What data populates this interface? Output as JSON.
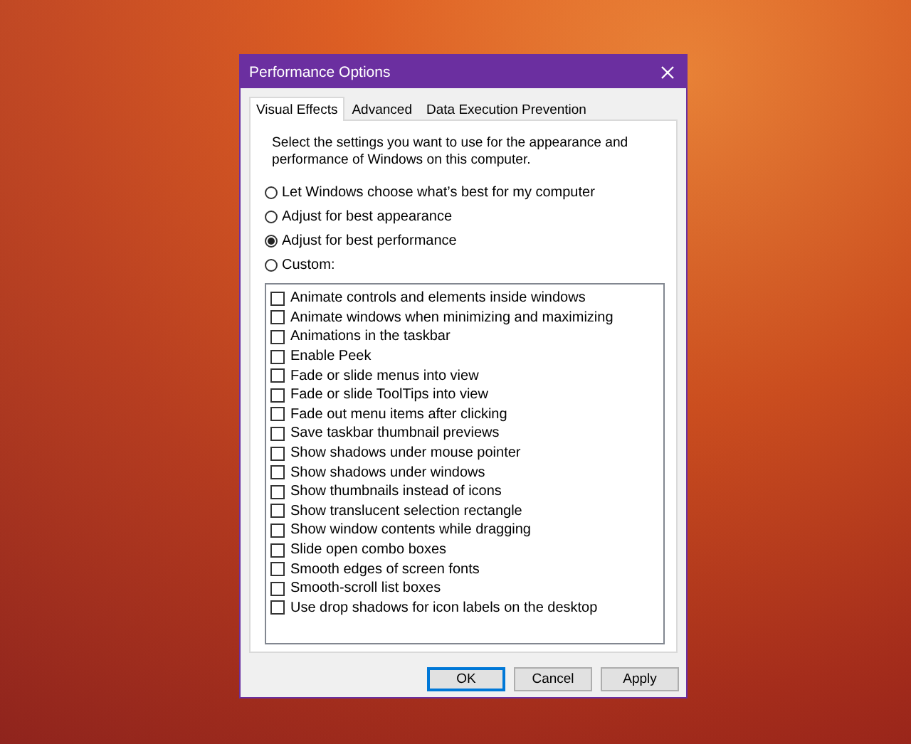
{
  "window": {
    "title": "Performance Options"
  },
  "tabs": [
    {
      "label": "Visual Effects",
      "selected": true
    },
    {
      "label": "Advanced",
      "selected": false
    },
    {
      "label": "Data Execution Prevention",
      "selected": false
    }
  ],
  "description": "Select the settings you want to use for the appearance and performance of Windows on this computer.",
  "options": [
    {
      "label": "Let Windows choose what’s best for my computer",
      "selected": false
    },
    {
      "label": "Adjust for best appearance",
      "selected": false
    },
    {
      "label": "Adjust for best performance",
      "selected": true
    },
    {
      "label": "Custom:",
      "selected": false
    }
  ],
  "effects": [
    {
      "label": "Animate controls and elements inside windows",
      "checked": false
    },
    {
      "label": "Animate windows when minimizing and maximizing",
      "checked": false
    },
    {
      "label": "Animations in the taskbar",
      "checked": false
    },
    {
      "label": "Enable Peek",
      "checked": false
    },
    {
      "label": "Fade or slide menus into view",
      "checked": false
    },
    {
      "label": "Fade or slide ToolTips into view",
      "checked": false
    },
    {
      "label": "Fade out menu items after clicking",
      "checked": false
    },
    {
      "label": "Save taskbar thumbnail previews",
      "checked": false
    },
    {
      "label": "Show shadows under mouse pointer",
      "checked": false
    },
    {
      "label": "Show shadows under windows",
      "checked": false
    },
    {
      "label": "Show thumbnails instead of icons",
      "checked": false
    },
    {
      "label": "Show translucent selection rectangle",
      "checked": false
    },
    {
      "label": "Show window contents while dragging",
      "checked": false
    },
    {
      "label": "Slide open combo boxes",
      "checked": false
    },
    {
      "label": "Smooth edges of screen fonts",
      "checked": false
    },
    {
      "label": "Smooth-scroll list boxes",
      "checked": false
    },
    {
      "label": "Use drop shadows for icon labels on the desktop",
      "checked": false
    }
  ],
  "buttons": [
    {
      "label": "OK",
      "kind": "default"
    },
    {
      "label": "Cancel",
      "kind": "normal"
    },
    {
      "label": "Apply",
      "kind": "normal"
    }
  ]
}
